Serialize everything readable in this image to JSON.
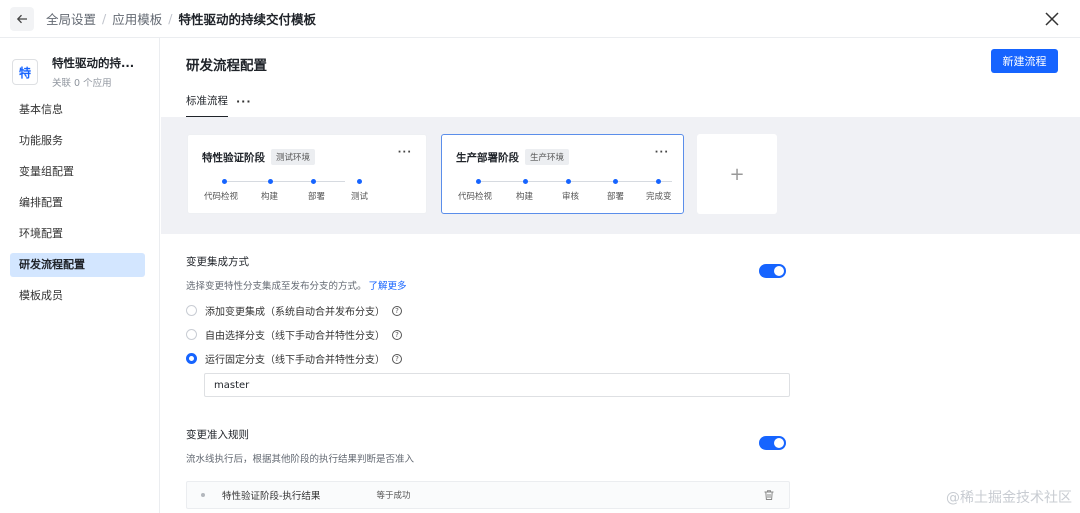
{
  "breadcrumb": {
    "items": [
      "全局设置",
      "应用模板"
    ],
    "separator": "/",
    "current": "特性驱动的持续交付模板"
  },
  "app": {
    "avatar": "特",
    "name": "特性驱动的持...",
    "subtitle": "关联 0 个应用"
  },
  "sidebar": {
    "items": [
      {
        "label": "基本信息"
      },
      {
        "label": "功能服务"
      },
      {
        "label": "变量组配置"
      },
      {
        "label": "编排配置"
      },
      {
        "label": "环境配置"
      },
      {
        "label": "研发流程配置"
      },
      {
        "label": "模板成员"
      }
    ],
    "active_index": 5
  },
  "main": {
    "title": "研发流程配置",
    "new_button": "新建流程",
    "tab": "标准流程",
    "tab_more": "···"
  },
  "stages": [
    {
      "name": "特性验证阶段",
      "env": "测试环境",
      "more": "···",
      "steps": [
        "代码检视",
        "构建",
        "部署",
        "测试"
      ]
    },
    {
      "name": "生产部署阶段",
      "env": "生产环境",
      "more": "···",
      "steps": [
        "代码检视",
        "构建",
        "审核",
        "部署",
        "完成变"
      ]
    }
  ],
  "add_stage": "+",
  "integration": {
    "title": "变更集成方式",
    "desc": "选择变更特性分支集成至发布分支的方式。",
    "link": "了解更多",
    "enabled": true,
    "options": [
      {
        "label": "添加变更集成（系统自动合并发布分支）",
        "checked": false
      },
      {
        "label": "自由选择分支（线下手动合并特性分支）",
        "checked": false
      },
      {
        "label": "运行固定分支（线下手动合并特性分支）",
        "checked": true
      }
    ],
    "help": "?",
    "branch_value": "master"
  },
  "admission": {
    "title": "变更准入规则",
    "desc": "流水线执行后，根据其他阶段的执行结果判断是否准入",
    "enabled": true,
    "rules": [
      {
        "name": "特性验证阶段-执行结果",
        "operator": "等于成功"
      }
    ]
  },
  "watermark": "@稀土掘金技术社区",
  "colors": {
    "accent": "#1664ff",
    "active_nav_bg": "#d3e6ff",
    "stage_bg": "#f0f1f5"
  }
}
